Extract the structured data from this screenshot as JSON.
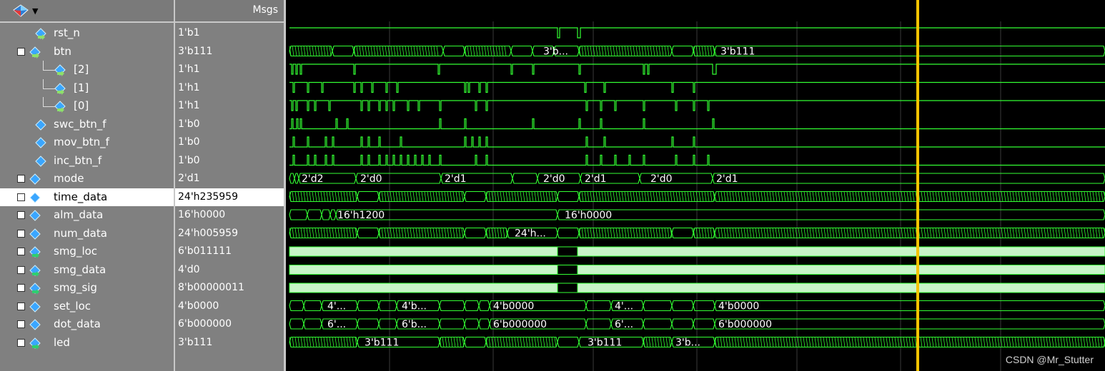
{
  "header": {
    "msgs_label": "Msgs"
  },
  "signals": [
    {
      "id": "rst_n",
      "name": "rst_n",
      "value": "1'b1",
      "indent": 1,
      "expander": "",
      "icon": "signal-in"
    },
    {
      "id": "btn",
      "name": "btn",
      "value": "3'b111",
      "indent": 0,
      "expander": "−",
      "icon": "bus-in"
    },
    {
      "id": "btn2",
      "name": "[2]",
      "value": "1'h1",
      "indent": 2,
      "expander": "",
      "icon": "signal-in"
    },
    {
      "id": "btn1",
      "name": "[1]",
      "value": "1'h1",
      "indent": 2,
      "expander": "",
      "icon": "signal-in"
    },
    {
      "id": "btn0",
      "name": "[0]",
      "value": "1'h1",
      "indent": 2,
      "expander": "",
      "icon": "signal-in"
    },
    {
      "id": "swc_btn_f",
      "name": "swc_btn_f",
      "value": "1'b0",
      "indent": 1,
      "expander": "",
      "icon": "signal"
    },
    {
      "id": "mov_btn_f",
      "name": "mov_btn_f",
      "value": "1'b0",
      "indent": 1,
      "expander": "",
      "icon": "signal"
    },
    {
      "id": "inc_btn_f",
      "name": "inc_btn_f",
      "value": "1'b0",
      "indent": 1,
      "expander": "",
      "icon": "signal"
    },
    {
      "id": "mode",
      "name": "mode",
      "value": "2'd1",
      "indent": 0,
      "expander": "+",
      "icon": "bus"
    },
    {
      "id": "time_data",
      "name": "time_data",
      "value": "24'h235959",
      "indent": 0,
      "expander": "+",
      "icon": "bus",
      "selected": true
    },
    {
      "id": "alm_data",
      "name": "alm_data",
      "value": "16'h0000",
      "indent": 0,
      "expander": "+",
      "icon": "bus"
    },
    {
      "id": "num_data",
      "name": "num_data",
      "value": "24'h005959",
      "indent": 0,
      "expander": "+",
      "icon": "bus"
    },
    {
      "id": "smg_loc",
      "name": "smg_loc",
      "value": "6'b011111",
      "indent": 0,
      "expander": "+",
      "icon": "bus-out"
    },
    {
      "id": "smg_data",
      "name": "smg_data",
      "value": "4'd0",
      "indent": 0,
      "expander": "+",
      "icon": "bus-out"
    },
    {
      "id": "smg_sig",
      "name": "smg_sig",
      "value": "8'b00000011",
      "indent": 0,
      "expander": "+",
      "icon": "bus-out"
    },
    {
      "id": "set_loc",
      "name": "set_loc",
      "value": "4'b0000",
      "indent": 0,
      "expander": "+",
      "icon": "bus"
    },
    {
      "id": "dot_data",
      "name": "dot_data",
      "value": "6'b000000",
      "indent": 0,
      "expander": "+",
      "icon": "bus"
    },
    {
      "id": "led",
      "name": "led",
      "value": "3'b111",
      "indent": 0,
      "expander": "+",
      "icon": "bus-out"
    }
  ],
  "wave_labels": {
    "btn": [
      "3'b...",
      "3'b111"
    ],
    "mode": [
      "2'd2",
      "2'd0",
      "2'd1",
      "2'd0",
      "2'd1",
      "2'd0",
      "2'd1"
    ],
    "alm_data": [
      "16'h1200",
      "16'h0000"
    ],
    "num_data": [
      "24'h..."
    ],
    "set_loc": [
      "4'...",
      "4'b...",
      "4'b0000",
      "4'...",
      "4'b0000"
    ],
    "dot_data": [
      "6'...",
      "6'b...",
      "6'b000000",
      "6'...",
      "6'b000000"
    ],
    "led": [
      "3'b111",
      "3'b111",
      "3'b..."
    ]
  },
  "colors": {
    "wave": "#33ff33",
    "bus_fill": "#c8f5c8",
    "cursor": "#f5c400",
    "grid": "#3a3a3a"
  },
  "watermark": "CSDN @Mr_Stutter"
}
